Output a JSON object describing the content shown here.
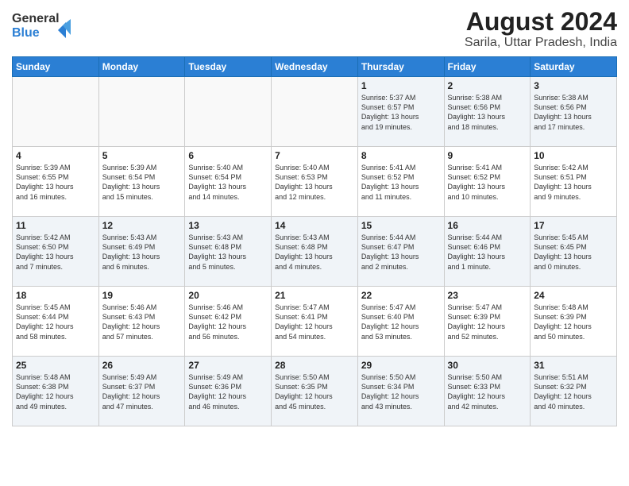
{
  "header": {
    "logo_line1": "General",
    "logo_line2": "Blue",
    "title": "August 2024",
    "subtitle": "Sarila, Uttar Pradesh, India"
  },
  "weekdays": [
    "Sunday",
    "Monday",
    "Tuesday",
    "Wednesday",
    "Thursday",
    "Friday",
    "Saturday"
  ],
  "weeks": [
    [
      {
        "day": "",
        "info": ""
      },
      {
        "day": "",
        "info": ""
      },
      {
        "day": "",
        "info": ""
      },
      {
        "day": "",
        "info": ""
      },
      {
        "day": "1",
        "info": "Sunrise: 5:37 AM\nSunset: 6:57 PM\nDaylight: 13 hours\nand 19 minutes."
      },
      {
        "day": "2",
        "info": "Sunrise: 5:38 AM\nSunset: 6:56 PM\nDaylight: 13 hours\nand 18 minutes."
      },
      {
        "day": "3",
        "info": "Sunrise: 5:38 AM\nSunset: 6:56 PM\nDaylight: 13 hours\nand 17 minutes."
      }
    ],
    [
      {
        "day": "4",
        "info": "Sunrise: 5:39 AM\nSunset: 6:55 PM\nDaylight: 13 hours\nand 16 minutes."
      },
      {
        "day": "5",
        "info": "Sunrise: 5:39 AM\nSunset: 6:54 PM\nDaylight: 13 hours\nand 15 minutes."
      },
      {
        "day": "6",
        "info": "Sunrise: 5:40 AM\nSunset: 6:54 PM\nDaylight: 13 hours\nand 14 minutes."
      },
      {
        "day": "7",
        "info": "Sunrise: 5:40 AM\nSunset: 6:53 PM\nDaylight: 13 hours\nand 12 minutes."
      },
      {
        "day": "8",
        "info": "Sunrise: 5:41 AM\nSunset: 6:52 PM\nDaylight: 13 hours\nand 11 minutes."
      },
      {
        "day": "9",
        "info": "Sunrise: 5:41 AM\nSunset: 6:52 PM\nDaylight: 13 hours\nand 10 minutes."
      },
      {
        "day": "10",
        "info": "Sunrise: 5:42 AM\nSunset: 6:51 PM\nDaylight: 13 hours\nand 9 minutes."
      }
    ],
    [
      {
        "day": "11",
        "info": "Sunrise: 5:42 AM\nSunset: 6:50 PM\nDaylight: 13 hours\nand 7 minutes."
      },
      {
        "day": "12",
        "info": "Sunrise: 5:43 AM\nSunset: 6:49 PM\nDaylight: 13 hours\nand 6 minutes."
      },
      {
        "day": "13",
        "info": "Sunrise: 5:43 AM\nSunset: 6:48 PM\nDaylight: 13 hours\nand 5 minutes."
      },
      {
        "day": "14",
        "info": "Sunrise: 5:43 AM\nSunset: 6:48 PM\nDaylight: 13 hours\nand 4 minutes."
      },
      {
        "day": "15",
        "info": "Sunrise: 5:44 AM\nSunset: 6:47 PM\nDaylight: 13 hours\nand 2 minutes."
      },
      {
        "day": "16",
        "info": "Sunrise: 5:44 AM\nSunset: 6:46 PM\nDaylight: 13 hours\nand 1 minute."
      },
      {
        "day": "17",
        "info": "Sunrise: 5:45 AM\nSunset: 6:45 PM\nDaylight: 13 hours\nand 0 minutes."
      }
    ],
    [
      {
        "day": "18",
        "info": "Sunrise: 5:45 AM\nSunset: 6:44 PM\nDaylight: 12 hours\nand 58 minutes."
      },
      {
        "day": "19",
        "info": "Sunrise: 5:46 AM\nSunset: 6:43 PM\nDaylight: 12 hours\nand 57 minutes."
      },
      {
        "day": "20",
        "info": "Sunrise: 5:46 AM\nSunset: 6:42 PM\nDaylight: 12 hours\nand 56 minutes."
      },
      {
        "day": "21",
        "info": "Sunrise: 5:47 AM\nSunset: 6:41 PM\nDaylight: 12 hours\nand 54 minutes."
      },
      {
        "day": "22",
        "info": "Sunrise: 5:47 AM\nSunset: 6:40 PM\nDaylight: 12 hours\nand 53 minutes."
      },
      {
        "day": "23",
        "info": "Sunrise: 5:47 AM\nSunset: 6:39 PM\nDaylight: 12 hours\nand 52 minutes."
      },
      {
        "day": "24",
        "info": "Sunrise: 5:48 AM\nSunset: 6:39 PM\nDaylight: 12 hours\nand 50 minutes."
      }
    ],
    [
      {
        "day": "25",
        "info": "Sunrise: 5:48 AM\nSunset: 6:38 PM\nDaylight: 12 hours\nand 49 minutes."
      },
      {
        "day": "26",
        "info": "Sunrise: 5:49 AM\nSunset: 6:37 PM\nDaylight: 12 hours\nand 47 minutes."
      },
      {
        "day": "27",
        "info": "Sunrise: 5:49 AM\nSunset: 6:36 PM\nDaylight: 12 hours\nand 46 minutes."
      },
      {
        "day": "28",
        "info": "Sunrise: 5:50 AM\nSunset: 6:35 PM\nDaylight: 12 hours\nand 45 minutes."
      },
      {
        "day": "29",
        "info": "Sunrise: 5:50 AM\nSunset: 6:34 PM\nDaylight: 12 hours\nand 43 minutes."
      },
      {
        "day": "30",
        "info": "Sunrise: 5:50 AM\nSunset: 6:33 PM\nDaylight: 12 hours\nand 42 minutes."
      },
      {
        "day": "31",
        "info": "Sunrise: 5:51 AM\nSunset: 6:32 PM\nDaylight: 12 hours\nand 40 minutes."
      }
    ]
  ]
}
